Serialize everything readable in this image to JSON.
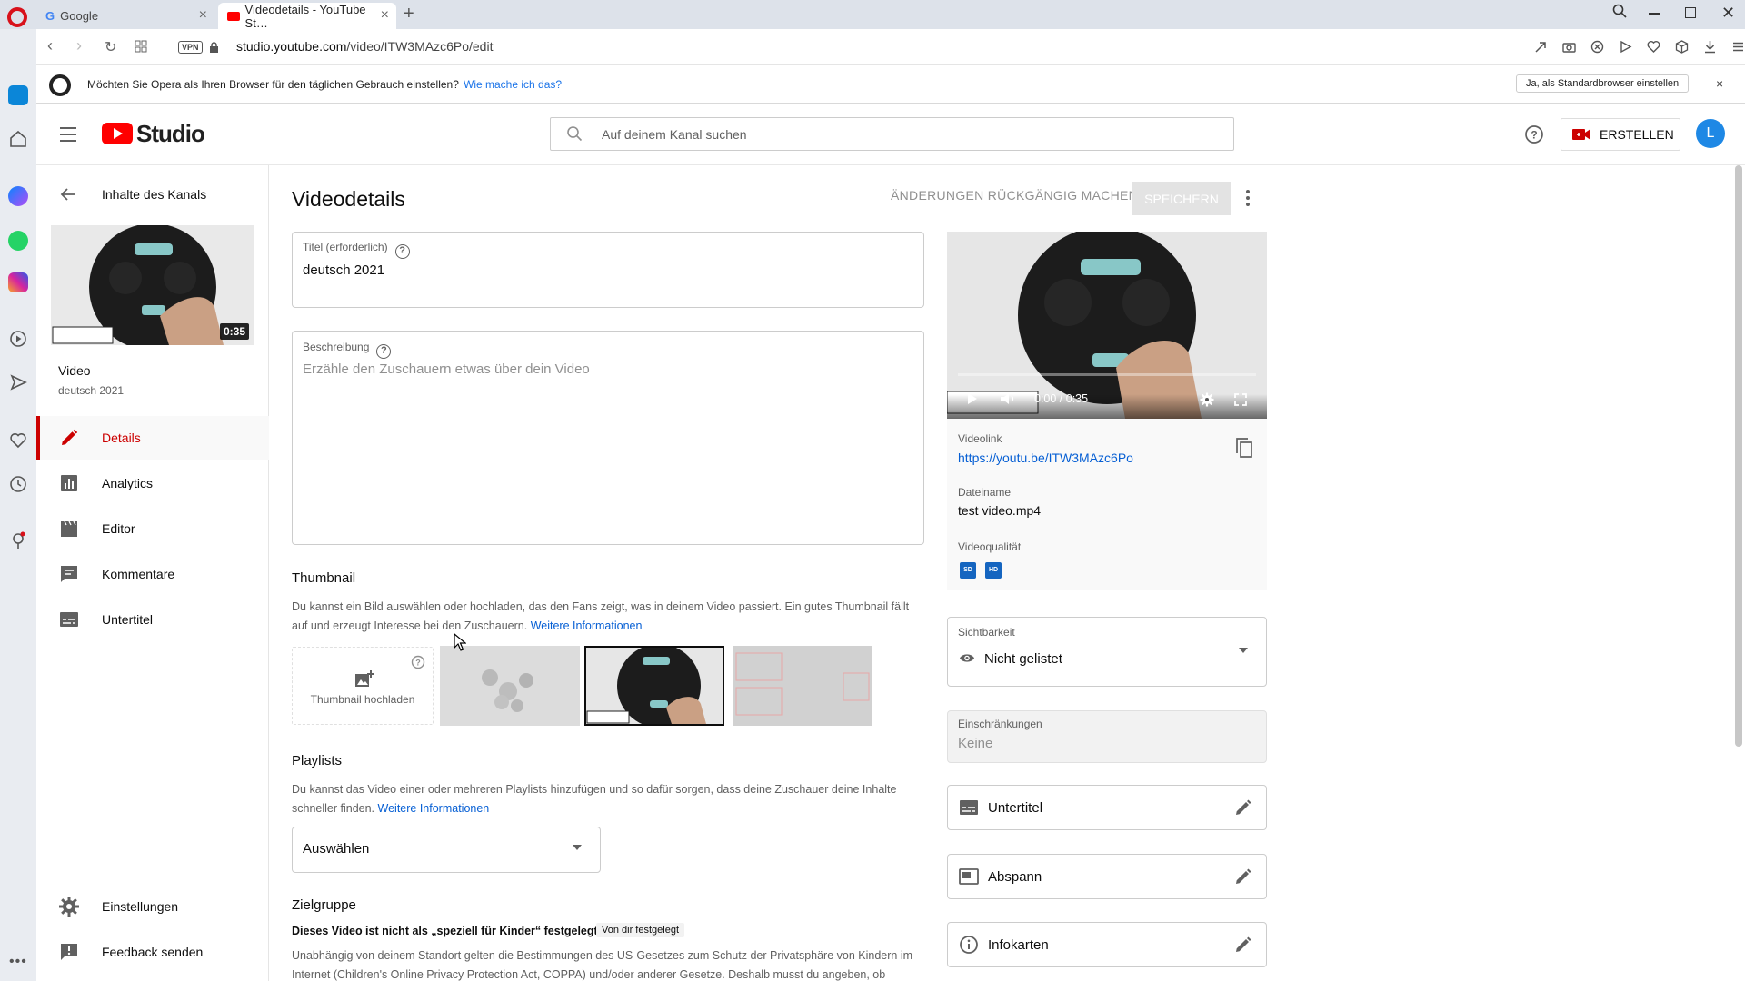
{
  "browser": {
    "tabs": [
      {
        "label": "Google",
        "close": "×"
      },
      {
        "label": "Videodetails - YouTube St…",
        "close": "×"
      }
    ],
    "new_tab": "+",
    "url_domain": "studio.youtube.com",
    "url_path": "/video/ITW3MAzc6Po/edit",
    "vpn_label": "VPN",
    "infobar": {
      "message": "Möchten Sie Opera als Ihren Browser für den täglichen Gebrauch einstellen?",
      "link": "Wie mache ich das?",
      "button": "Ja, als Standardbrowser einstellen",
      "close": "×"
    }
  },
  "header": {
    "logo_text": "Studio",
    "search_placeholder": "Auf deinem Kanal suchen",
    "create_label": "ERSTELLEN",
    "avatar_letter": "L"
  },
  "leftnav": {
    "back_label": "Inhalte des Kanals",
    "thumb_duration": "0:35",
    "video_heading": "Video",
    "video_title": "deutsch 2021",
    "items": [
      {
        "label": "Details",
        "icon": "pencil-icon",
        "active": true
      },
      {
        "label": "Analytics",
        "icon": "bar-chart-icon"
      },
      {
        "label": "Editor",
        "icon": "clapperboard-icon"
      },
      {
        "label": "Kommentare",
        "icon": "comment-icon"
      },
      {
        "label": "Untertitel",
        "icon": "subtitles-icon"
      }
    ],
    "bottom_items": [
      {
        "label": "Einstellungen",
        "icon": "gear-icon"
      },
      {
        "label": "Feedback senden",
        "icon": "feedback-icon"
      }
    ]
  },
  "main": {
    "page_title": "Videodetails",
    "undo_label": "ÄNDERUNGEN RÜCKGÄNGIG MACHEN",
    "save_label": "SPEICHERN",
    "title_field": {
      "label": "Titel (erforderlich)",
      "value": "deutsch 2021"
    },
    "description_field": {
      "label": "Beschreibung",
      "placeholder": "Erzähle den Zuschauern etwas über dein Video"
    },
    "thumbnail": {
      "heading": "Thumbnail",
      "text": "Du kannst ein Bild auswählen oder hochladen, das den Fans zeigt, was in deinem Video passiert. Ein gutes Thumbnail fällt auf und erzeugt Interesse bei den Zuschauern.",
      "link": "Weitere Informationen",
      "upload_label": "Thumbnail hochladen"
    },
    "playlists": {
      "heading": "Playlists",
      "text": "Du kannst das Video einer oder mehreren Playlists hinzufügen und so dafür sorgen, dass deine Zuschauer deine Inhalte schneller finden.",
      "link": "Weitere Informationen",
      "select_value": "Auswählen"
    },
    "audience": {
      "heading": "Zielgruppe",
      "status": "Dieses Video ist nicht als „speziell für Kinder“ festgelegt",
      "badge": "Von dir festgelegt",
      "text": "Unabhängig von deinem Standort gelten die Bestimmungen des US-Gesetzes zum Schutz der Privatsphäre von Kindern im Internet (Children's Online Privacy Protection Act, COPPA) und/oder anderer Gesetze. Deshalb musst du angeben, ob"
    }
  },
  "right": {
    "player_time": "0:00 / 0:35",
    "video_link_label": "Videolink",
    "video_link": "https://youtu.be/ITW3MAzc6Po",
    "filename_label": "Dateiname",
    "filename": "test video.mp4",
    "quality_label": "Videoqualität",
    "quality_badges": [
      "SD",
      "HD"
    ],
    "visibility_label": "Sichtbarkeit",
    "visibility_value": "Nicht gelistet",
    "restrictions_label": "Einschränkungen",
    "restrictions_value": "Keine",
    "buttons": [
      {
        "label": "Untertitel",
        "icon": "subtitles-icon"
      },
      {
        "label": "Abspann",
        "icon": "end-screen-icon"
      },
      {
        "label": "Infokarten",
        "icon": "info-icon"
      }
    ]
  },
  "accent": "#cc0000",
  "link_color": "#065fd4"
}
